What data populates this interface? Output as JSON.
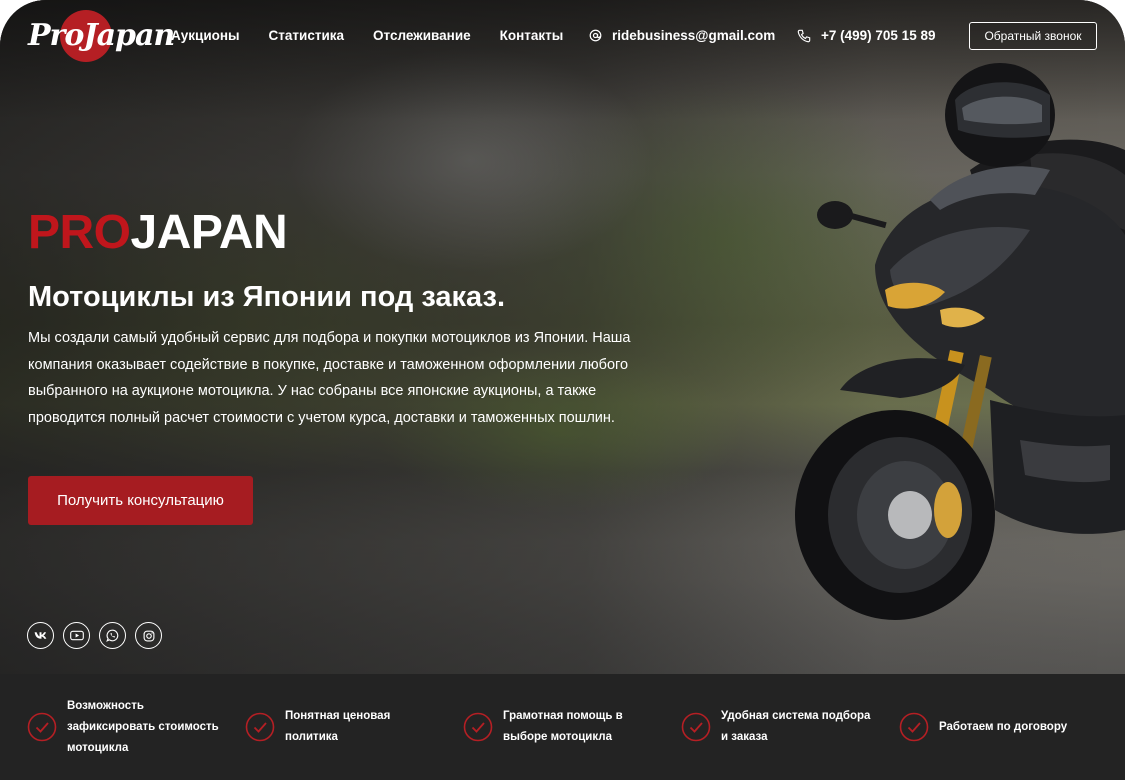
{
  "header": {
    "logo": "ProJapan",
    "nav": [
      "Аукционы",
      "Статистика",
      "Отслеживание",
      "Контакты"
    ],
    "email": "ridebusiness@gmail.com",
    "phone": "+7 (499) 705 15 89",
    "callback_label": "Обратный звонок"
  },
  "hero": {
    "brand_red": "PRO",
    "brand_white": "JAPAN",
    "headline": "Мотоциклы из Японии под заказ.",
    "description_lines": [
      "Мы создали самый удобный сервис для подбора и покупки мотоциклов из Японии. Наша",
      "компания оказывает содействие в покупке, доставке и таможенном оформлении любого",
      "выбранного на аукционе мотоцикла. У нас собраны все японские аукционы, а также",
      "проводится полный расчет стоимости с учетом курса, доставки и таможенных пошлин."
    ],
    "cta_label": "Получить консультацию"
  },
  "socials": [
    "vk-icon",
    "youtube-icon",
    "whatsapp-icon",
    "instagram-icon"
  ],
  "features": [
    {
      "lines": [
        "Возможность",
        "зафиксировать стоимость",
        "мотоцикла"
      ]
    },
    {
      "lines": [
        "Понятная ценовая",
        "политика"
      ]
    },
    {
      "lines": [
        "Грамотная помощь в",
        "выборе мотоцикла"
      ]
    },
    {
      "lines": [
        "Удобная система подбора",
        "и заказа"
      ]
    },
    {
      "lines": [
        "Работаем по договору"
      ]
    }
  ],
  "colors": {
    "accent_red": "#a61c21",
    "brand_red": "#c0161c",
    "feature_bar": "#232323"
  }
}
